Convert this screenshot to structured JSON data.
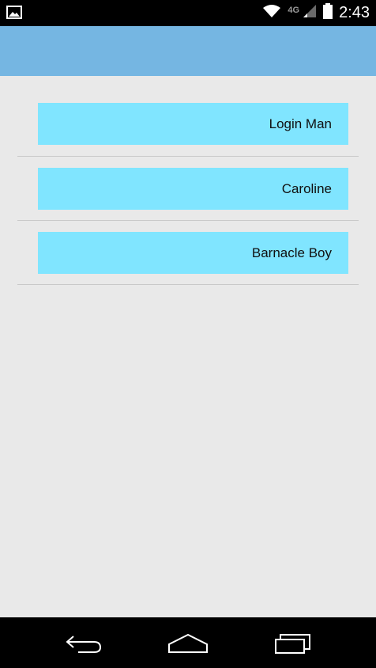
{
  "status_bar": {
    "time": "2:43",
    "network_label": "4G",
    "icons": [
      "image-notification-icon",
      "wifi-icon",
      "signal-icon",
      "battery-icon"
    ]
  },
  "action_bar": {},
  "list": {
    "items": [
      {
        "label": "Login Man"
      },
      {
        "label": "Caroline"
      },
      {
        "label": "Barnacle Boy"
      }
    ]
  },
  "nav_bar": {
    "icons": [
      "back-icon",
      "home-icon",
      "recent-apps-icon"
    ]
  },
  "colors": {
    "action_bar": "#75b6e2",
    "item_button": "#80e5ff",
    "background": "#e9e9e9"
  }
}
